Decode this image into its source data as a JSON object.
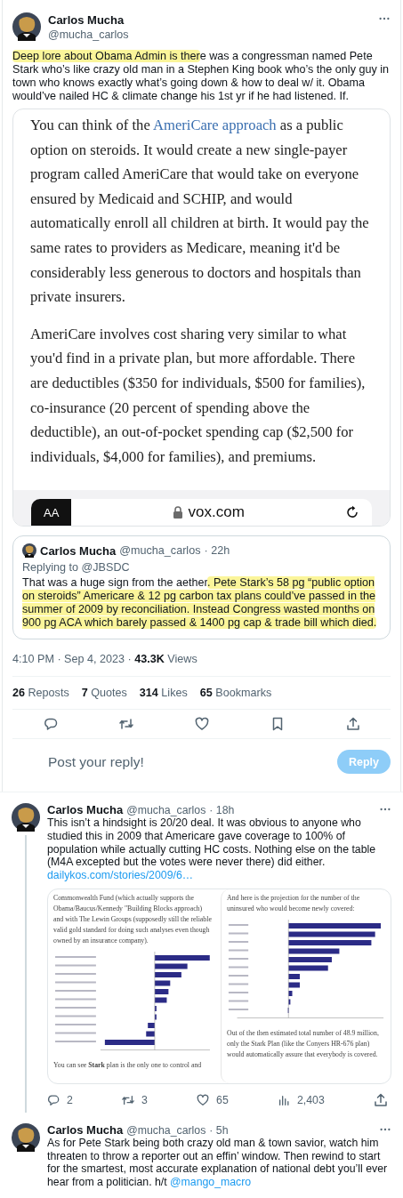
{
  "main_tweet": {
    "author": {
      "name": "Carlos Mucha",
      "handle": "@mucha_carlos"
    },
    "text": [
      {
        "text": "Deep lore about Obama Admin is ther",
        "kind": "highlight"
      },
      {
        "text": "e was a congressman named Pete Stark who’s like crazy old man in a Stephen King book who’s the only guy in town who knows exactly what’s going down & how to deal w/ it. Obama would’ve nailed HC & climate change his 1st yr if he had listened. If.",
        "kind": "plain"
      }
    ],
    "article_card": {
      "paragraphs": [
        [
          {
            "text": "You can think of the ",
            "kind": "plain"
          },
          {
            "text": "AmeriCare approach",
            "kind": "link"
          },
          {
            "text": " as a public option on steroids. It would create a new single-payer program called AmeriCare that would take on everyone ensured by Medicaid and SCHIP, and would automatically enroll all children at birth. It would pay the same rates to providers as Medicare, meaning it'd be considerably less generous to doctors and hospitals than private insurers.",
            "kind": "plain"
          }
        ],
        [
          {
            "text": "AmeriCare involves cost sharing very similar to what you'd find in a private plan, but more affordable. There are deductibles ($350 for individuals, $500 for families), co-insurance (20 percent of spending above the deductible), an out-of-pocket spending cap ($2,500 for individuals, $4,000 for families), and premiums.",
            "kind": "plain"
          }
        ]
      ],
      "browser_bar": {
        "text_size_button": "AA",
        "domain": "vox.com"
      }
    },
    "quote": {
      "name": "Carlos Mucha",
      "handle": "@mucha_carlos",
      "time": "· 22h",
      "replying_to": "Replying to @JBSDC",
      "text": [
        {
          "text": "That was a huge sign from the aether",
          "kind": "plain"
        },
        {
          "text": ". Pete Stark’s 58 pg “public option on steroids” Americare & 12 pg carbon tax plans could’ve passed in the summer of 2009 by reconciliation. Instead Congress wasted months on 900 pg ACA which barely passed & 1400 pg cap & trade bill which died.",
          "kind": "highlight"
        }
      ]
    },
    "timestamp": "4:10 PM · Sep 4, 2023 · **43.3K** Views",
    "stats": [
      "**26** Reposts",
      "**7** Quotes",
      "**314** Likes",
      "**65** Bookmarks"
    ],
    "actions": [
      {
        "kind": "reply"
      },
      {
        "kind": "repost"
      },
      {
        "kind": "like"
      },
      {
        "kind": "bookmark"
      },
      {
        "kind": "share"
      }
    ]
  },
  "reply_composer": {
    "placeholder": "Post your reply!",
    "button": "Reply",
    "disabled": true
  },
  "thread": [
    {
      "name": "Carlos Mucha",
      "handle": "@mucha_carlos",
      "time": "· 18h",
      "connected": true,
      "text": [
        {
          "text": "This isn’t a hindsight is 20/20 deal. It was obvious to anyone who studied this in 2009 that Americare gave coverage to 100% of population while actually cutting HC costs. Nothing else on the table (M4A excepted but the votes were never there) did either. ",
          "kind": "plain"
        },
        {
          "text": "dailykos.com/stories/2009/6…",
          "kind": "link"
        }
      ],
      "document": {
        "left": {
          "intro": "Commonwealth Fund (which actually supports the Obama/Baucus/Kennedy \"Building Blocks approach) and with The Lewin Groups (supposedly still the reliable valid gold standard for doing such analyses even though owned by an insurance company).",
          "caption": "You can see **Stark** plan is the only one to control and"
        },
        "right": {
          "intro": "And here is the projection for the number of the uninsured who would become newly covered:",
          "caption": "Out of the then estimated total number of 48.9 million, only the Stark Plan (like the Conyers HR-676 plan) would automatically assure that everybody is covered."
        }
      },
      "actions": [
        {
          "kind": "reply",
          "count": "2"
        },
        {
          "kind": "repost",
          "count": "3"
        },
        {
          "kind": "like",
          "count": "65"
        },
        {
          "kind": "views",
          "count": "2,403"
        },
        {
          "kind": "share"
        }
      ]
    },
    {
      "name": "Carlos Mucha",
      "handle": "@mucha_carlos",
      "time": "· 5h",
      "connected": false,
      "text": [
        {
          "text": "As for Pete Stark being both crazy old man & town savior, watch him threaten to throw a reporter out an effin’ window. Then rewind to start for the smartest, most accurate explanation of national debt you’ll ever hear from a politician. h/t ",
          "kind": "plain"
        },
        {
          "text": "@mango_macro",
          "kind": "link"
        }
      ]
    }
  ]
}
